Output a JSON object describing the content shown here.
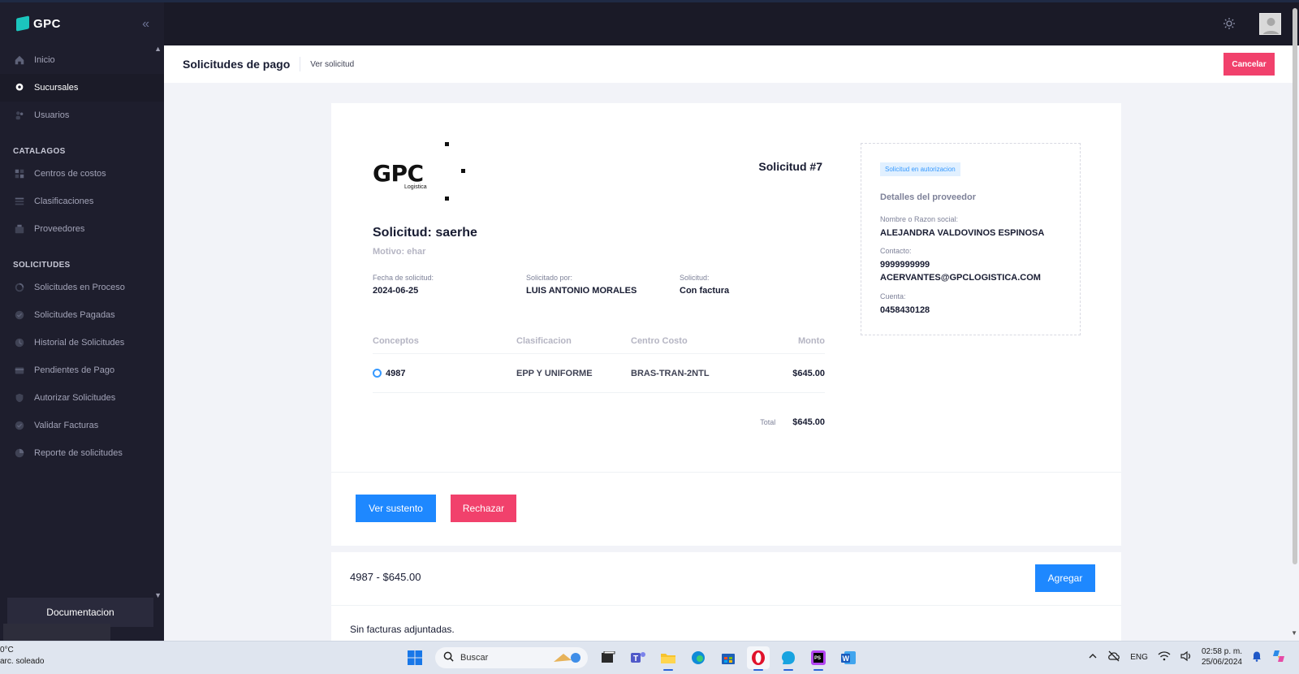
{
  "app": {
    "brand": "GPC",
    "collapse_glyph": "«"
  },
  "sidebar": {
    "items_top": [
      {
        "label": "Inicio",
        "icon": "home-icon"
      },
      {
        "label": "Sucursales",
        "icon": "location-icon",
        "active": true
      },
      {
        "label": "Usuarios",
        "icon": "users-icon"
      }
    ],
    "section_catalogos": "CATALAGOS",
    "items_catalogos": [
      {
        "label": "Centros de costos",
        "icon": "grid-icon"
      },
      {
        "label": "Clasificaciones",
        "icon": "list-icon"
      },
      {
        "label": "Proveedores",
        "icon": "briefcase-icon"
      }
    ],
    "section_solicitudes": "SOLICITUDES",
    "items_solicitudes": [
      {
        "label": "Solicitudes en Proceso",
        "icon": "spinner-icon"
      },
      {
        "label": "Solicitudes Pagadas",
        "icon": "check-circle-icon"
      },
      {
        "label": "Historial de Solicitudes",
        "icon": "history-icon"
      },
      {
        "label": "Pendientes de Pago",
        "icon": "card-icon"
      },
      {
        "label": "Autorizar Solicitudes",
        "icon": "shield-icon"
      },
      {
        "label": "Validar Facturas",
        "icon": "check-circle-icon"
      },
      {
        "label": "Reporte de solicitudes",
        "icon": "chart-icon"
      }
    ],
    "documentation": "Documentacion"
  },
  "subheader": {
    "title": "Solicitudes de pago",
    "breadcrumb": "Ver solicitud",
    "cancel_label": "Cancelar"
  },
  "request": {
    "logo_text": "GPC",
    "logo_subtitle": "Logistica",
    "number": "Solicitud #7",
    "title": "Solicitud: saerhe",
    "motivo": "Motivo: ehar",
    "fecha_label": "Fecha de solicitud:",
    "fecha_value": "2024-06-25",
    "solicitado_label": "Solicitado por:",
    "solicitado_value": "LUIS ANTONIO MORALES",
    "tipo_label": "Solicitud:",
    "tipo_value": "Con factura",
    "concepts_headers": [
      "Conceptos",
      "Clasificacion",
      "Centro Costo",
      "Monto"
    ],
    "concepts": [
      {
        "concepto": "4987",
        "clasificacion": "EPP Y UNIFORME",
        "centro": "BRAS-TRAN-2NTL",
        "monto": "$645.00"
      }
    ],
    "total_label": "Total",
    "total_value": "$645.00",
    "ver_sustento_label": "Ver sustento",
    "rechazar_label": "Rechazar"
  },
  "provider": {
    "status": "Solicitud en autorizacion",
    "title": "Detalles del proveedor",
    "name_label": "Nombre o Razon social:",
    "name_value": "ALEJANDRA VALDOVINOS ESPINOSA",
    "contact_label": "Contacto:",
    "contact_phone": "9999999999",
    "contact_email": "ACERVANTES@GPCLOGISTICA.COM",
    "account_label": "Cuenta:",
    "account_value": "0458430128"
  },
  "invoices": {
    "title": "4987 - $645.00",
    "add_label": "Agregar",
    "empty_text": "Sin facturas adjuntadas."
  },
  "taskbar": {
    "weather_temp": "0°C",
    "weather_text": "arc. soleado",
    "search_placeholder": "Buscar",
    "lang": "ENG",
    "time": "02:58 p. m.",
    "date": "25/06/2024"
  },
  "colors": {
    "sidebar_bg": "#1e1e2d",
    "primary": "#1e88ff",
    "danger": "#f1416c",
    "header_bg": "#1a1a27"
  }
}
